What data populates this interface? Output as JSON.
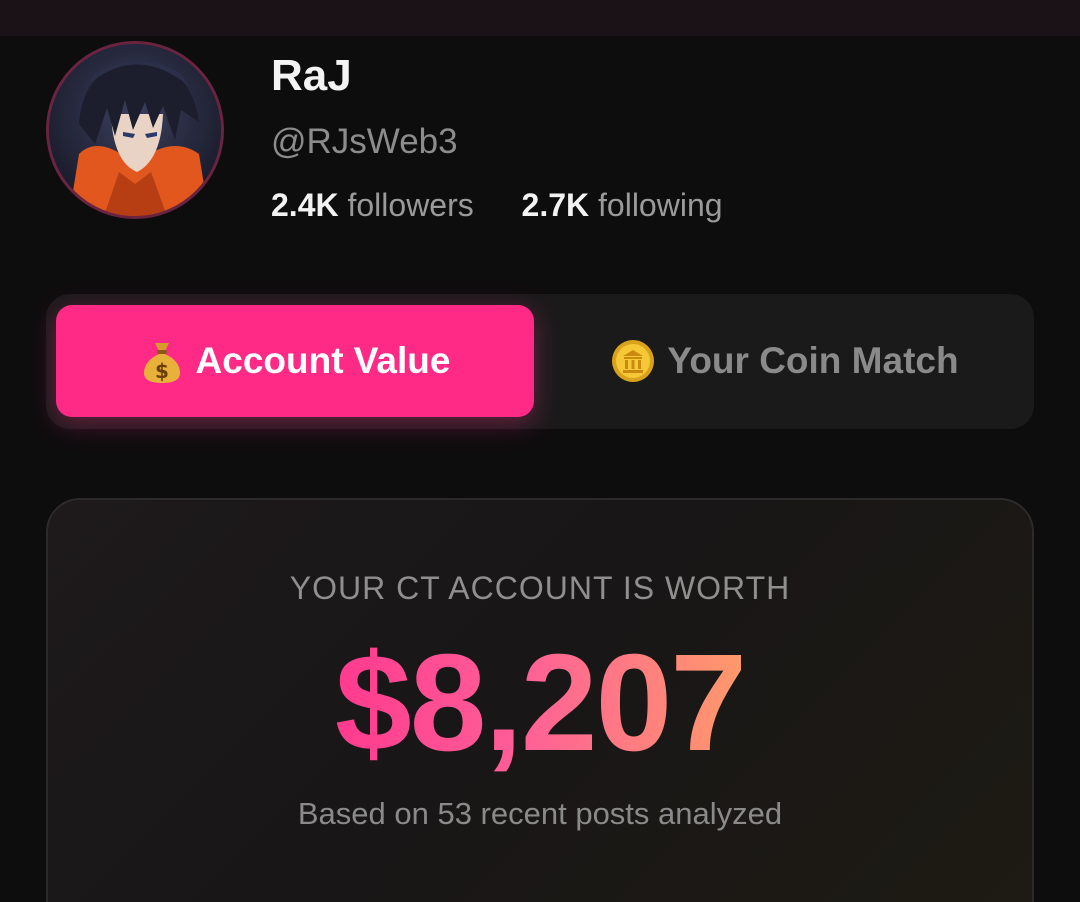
{
  "profile": {
    "name": "RaJ",
    "handle": "@RJsWeb3",
    "followers_count": "2.4K",
    "followers_label": "followers",
    "following_count": "2.7K",
    "following_label": "following"
  },
  "tabs": [
    {
      "label": "Account Value",
      "icon": "money-bag-icon",
      "active": true
    },
    {
      "label": "Your Coin Match",
      "icon": "coin-icon",
      "active": false
    }
  ],
  "card": {
    "label": "YOUR CT ACCOUNT IS WORTH",
    "value": "$8,207",
    "subtext": "Based on 53 recent posts analyzed"
  },
  "colors": {
    "accent": "#ff2a86",
    "background": "#0e0d0e",
    "value_gradient_start": "#ff3a8e",
    "value_gradient_end": "#ff9a6a"
  }
}
